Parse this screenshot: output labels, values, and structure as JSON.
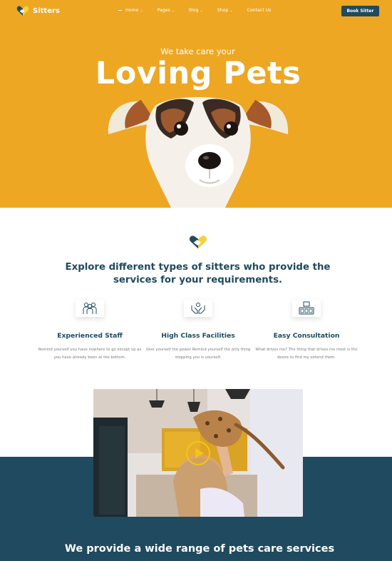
{
  "nav": {
    "logo_text": "Sitters",
    "items": [
      {
        "label": "Home",
        "caret": "⌄"
      },
      {
        "label": "Pages",
        "caret": "⌄"
      },
      {
        "label": "Blog",
        "caret": "⌄"
      },
      {
        "label": "Shop",
        "caret": "⌄"
      },
      {
        "label": "Contact Us",
        "caret": ""
      }
    ],
    "cta_label": "Book Sitter"
  },
  "hero": {
    "subtitle": "We take care your",
    "title": "Loving Pets"
  },
  "intro": {
    "heading": "Explore different types of sitters who provide the services for your requirements."
  },
  "features": [
    {
      "icon": "staff-icon",
      "title": "Experienced Staff",
      "desc": "Remind yourself you have nowhere to go except up as you have already been at the bottom."
    },
    {
      "icon": "hands-icon",
      "title": "High Class Facilities",
      "desc": "Give yourself the power Remind yourself the only thing stopping you is yourself."
    },
    {
      "icon": "consultation-icon",
      "title": "Easy Consultation",
      "desc": "What drives me? The thing that drives me most is the desire to find my extend them."
    }
  ],
  "video": {
    "icon": "play-icon"
  },
  "services": {
    "title": "We provide a wide range of pets care services"
  },
  "colors": {
    "accent": "#eda723",
    "brand": "#1f4a5f"
  }
}
